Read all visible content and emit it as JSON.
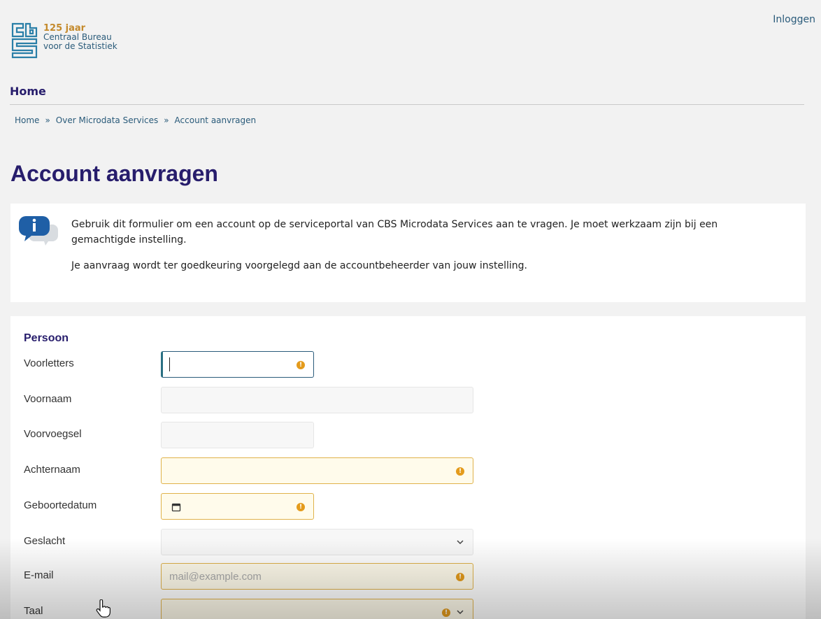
{
  "header": {
    "login_label": "Inloggen",
    "logo": {
      "years": "125 jaar",
      "line1": "Centraal Bureau",
      "line2": "voor de Statistiek"
    }
  },
  "nav": {
    "home_label": "Home"
  },
  "breadcrumb": {
    "items": [
      "Home",
      "Over Microdata Services",
      "Account aanvragen"
    ],
    "separator": "»"
  },
  "page": {
    "title": "Account aanvragen"
  },
  "info": {
    "paragraph1": "Gebruik dit formulier om een account op de serviceportal van CBS Microdata Services aan te vragen. Je moet werkzaam zijn bij een gemachtigde instelling.",
    "paragraph2": "Je aanvraag wordt ter goedkeuring voorgelegd aan de accountbeheerder van jouw instelling."
  },
  "form": {
    "section_title": "Persoon",
    "fields": {
      "voorletters": {
        "label": "Voorletters",
        "value": ""
      },
      "voornaam": {
        "label": "Voornaam",
        "value": ""
      },
      "voorvoegsel": {
        "label": "Voorvoegsel",
        "value": ""
      },
      "achternaam": {
        "label": "Achternaam",
        "value": ""
      },
      "geboortedatum": {
        "label": "Geboortedatum",
        "value": ""
      },
      "geslacht": {
        "label": "Geslacht",
        "value": ""
      },
      "email": {
        "label": "E-mail",
        "placeholder": "mail@example.com"
      },
      "taal": {
        "label": "Taal",
        "value": ""
      }
    },
    "warning_glyph": "!"
  },
  "colors": {
    "brand_navy": "#271d6c",
    "link_teal": "#2a5b7a",
    "logo_gold": "#c48a2c",
    "required_bg": "#fffbeb",
    "warning_orange": "#e49b1c"
  },
  "icons": [
    "cbs-logo-icon",
    "info-chat-icon",
    "warning-icon",
    "calendar-icon",
    "chevron-down-icon",
    "hand-cursor-icon"
  ]
}
